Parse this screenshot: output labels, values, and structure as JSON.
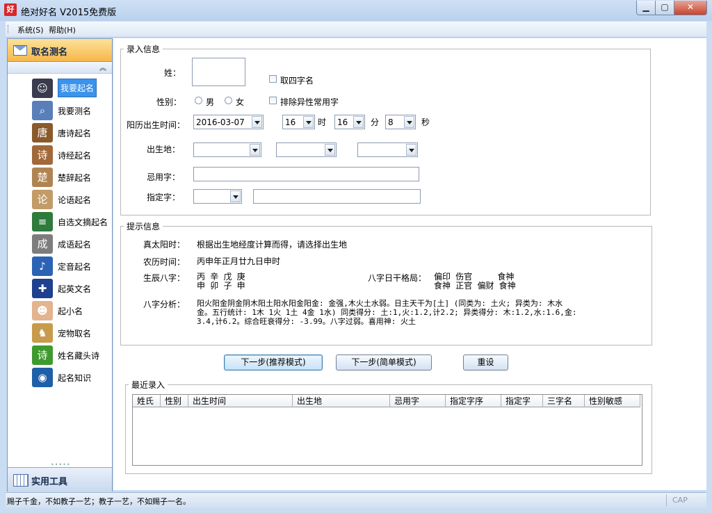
{
  "window": {
    "title": "绝对好名 V2015免费版",
    "icon_text": "好"
  },
  "menu": {
    "items": [
      "系统(S)",
      "帮助(H)"
    ]
  },
  "sidebar": {
    "header": "取名测名",
    "footer": "实用工具",
    "items": [
      {
        "label": "我要起名",
        "icon": "person-icon",
        "color": "#3b3b4f",
        "glyph": "☺",
        "selected": true
      },
      {
        "label": "我要测名",
        "icon": "magnifier-icon",
        "color": "#5a7fb8",
        "glyph": "⌕"
      },
      {
        "label": "唐诗起名",
        "icon": "tang-book-icon",
        "color": "#8a5a2b",
        "glyph": "唐"
      },
      {
        "label": "诗经起名",
        "icon": "shijing-book-icon",
        "color": "#a1683a",
        "glyph": "诗"
      },
      {
        "label": "楚辞起名",
        "icon": "chuci-book-icon",
        "color": "#b08452",
        "glyph": "楚"
      },
      {
        "label": "论语起名",
        "icon": "lunyu-book-icon",
        "color": "#c29b67",
        "glyph": "论"
      },
      {
        "label": "自选文摘起名",
        "icon": "books-stack-icon",
        "color": "#2f7a3d",
        "glyph": "≡"
      },
      {
        "label": "成语起名",
        "icon": "scroll-icon",
        "color": "#7d7d7d",
        "glyph": "成"
      },
      {
        "label": "定音起名",
        "icon": "speaker-icon",
        "color": "#2a63b5",
        "glyph": "♪"
      },
      {
        "label": "起英文名",
        "icon": "uk-flag-icon",
        "color": "#1f3f8f",
        "glyph": "✚"
      },
      {
        "label": "起小名",
        "icon": "baby-icon",
        "color": "#e2b48f",
        "glyph": "☻"
      },
      {
        "label": "宠物取名",
        "icon": "dog-icon",
        "color": "#c79a4c",
        "glyph": "♞"
      },
      {
        "label": "姓名藏头诗",
        "icon": "poem-icon",
        "color": "#3f9a2e",
        "glyph": "诗"
      },
      {
        "label": "起名知识",
        "icon": "globe-icon",
        "color": "#1f5fa8",
        "glyph": "◉"
      }
    ]
  },
  "entry": {
    "legend": "录入信息",
    "surname_label": "姓：",
    "four_char_label": "取四字名",
    "gender_label": "性别：",
    "male_label": "男",
    "female_label": "女",
    "exclude_label": "排除异性常用字",
    "birth_label": "阳历出生时间：",
    "birth_date": "2016-03-07",
    "hour": "16",
    "hour_label": "时",
    "minute": "16",
    "minute_label": "分",
    "second": "8",
    "second_label": "秒",
    "birthplace_label": "出生地：",
    "avoid_label": "忌用字：",
    "fixed_label": "指定字："
  },
  "hints": {
    "legend": "提示信息",
    "solar_label": "真太阳时：",
    "solar_value": "根据出生地经度计算而得，请选择出生地",
    "lunar_label": "农历时间：",
    "lunar_value": "丙申年正月廿九日申时",
    "bazi_label": "生辰八字：",
    "bazi_line1": "丙 辛 戊 庚",
    "bazi_line2": "申 卯 子 申",
    "gege_label": "八字日干格局：",
    "gege_line1": "偏印 伤官     食神",
    "gege_line2": "食神 正官 偏财 食神",
    "analysis_label": "八字分析：",
    "analysis_line1": "阳火阳金阴金阴木阳土阳水阳金阳金: 金强,木火土水弱。日主天干为[土] (同类为: 土火; 异类为: 木水",
    "analysis_line2": "金。五行统计: 1木 1火 1土 4金 1水) 同类得分: 土:1,火:1.2,计2.2; 异类得分: 木:1.2,水:1.6,金:",
    "analysis_line3": "3.4,计6.2。综合旺衰得分: -3.99。八字过弱。喜用神: 火土"
  },
  "buttons": {
    "next_recommend": "下一步(推荐模式)",
    "next_simple": "下一步(简单模式)",
    "reset": "重设"
  },
  "recent": {
    "legend": "最近录入",
    "columns": [
      "姓氏",
      "性别",
      "出生时间",
      "出生地",
      "忌用字",
      "指定字序",
      "指定字",
      "三字名",
      "性别敏感"
    ]
  },
  "status": {
    "text": "赐子千金，不如教子一艺；教子一艺，不如赐子一名。",
    "caps": "CAP"
  }
}
